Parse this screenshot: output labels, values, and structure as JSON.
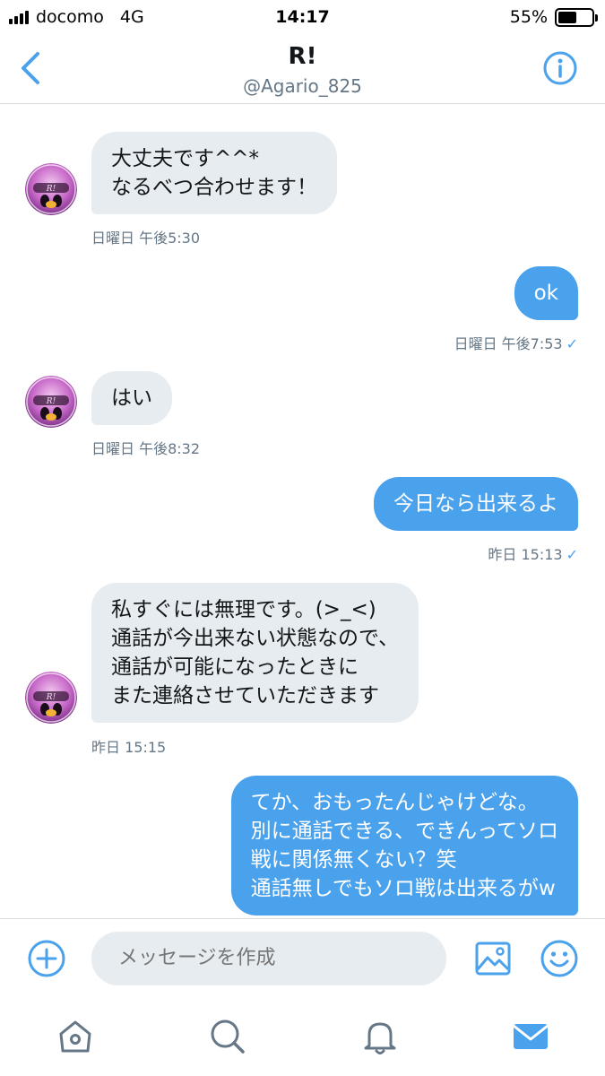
{
  "status_bar": {
    "carrier": "docomo",
    "network": "4G",
    "time": "14:17",
    "battery": "55%",
    "battery_level": 0.55
  },
  "header": {
    "name": "R!",
    "handle": "@Agario_825"
  },
  "messages": [
    {
      "direction": "in",
      "lines": [
        "大丈夫です^^*",
        "なるべつ合わせます！"
      ],
      "meta": "日曜日 午後5:30"
    },
    {
      "direction": "out",
      "lines": [
        "ok"
      ],
      "meta": "日曜日 午後7:53"
    },
    {
      "direction": "in",
      "lines": [
        "はい"
      ],
      "meta": "日曜日 午後8:32"
    },
    {
      "direction": "out",
      "lines": [
        "今日なら出来るよ"
      ],
      "meta": "昨日 15:13"
    },
    {
      "direction": "in",
      "lines": [
        "私すぐには無理です。(>_<)",
        "通話が今出来ない状態なので、",
        "通話が可能になったときに",
        "また連絡させていただきます"
      ],
      "meta": "昨日 15:15"
    },
    {
      "direction": "out",
      "lines": [
        "てか、おもったんじゃけどな。",
        "別に通話できる、できんってソロ",
        "戦に関係無くない？笑",
        "通話無しでもソロ戦は出来るがw"
      ],
      "meta": ""
    }
  ],
  "composer": {
    "placeholder": "メッセージを作成"
  },
  "icons": {
    "back": "chevron-left-icon",
    "info": "info-icon",
    "add": "plus-circle-icon",
    "media": "image-icon",
    "emoji": "emoji-icon",
    "home": "home-icon",
    "search": "search-icon",
    "notifications": "bell-icon",
    "messages": "mail-icon"
  },
  "colors": {
    "accent": "#4aa1ec",
    "incoming_bubble": "#e6ecf0",
    "muted_text": "#657786",
    "divider": "#d8dde1"
  }
}
